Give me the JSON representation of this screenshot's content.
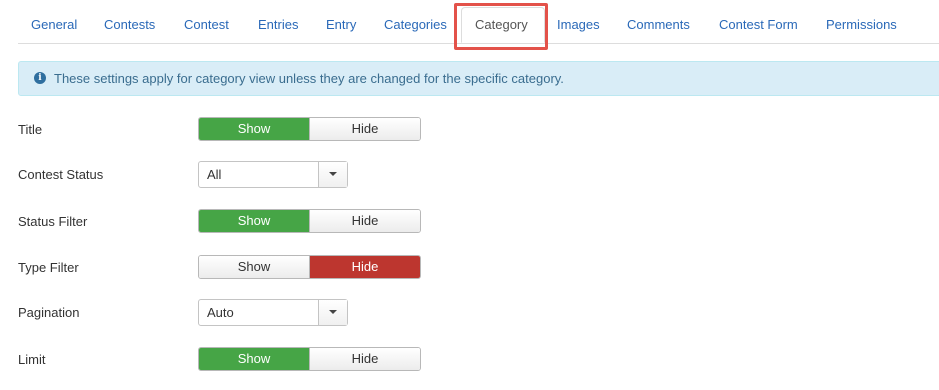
{
  "tabs": [
    {
      "label": "General"
    },
    {
      "label": "Contests"
    },
    {
      "label": "Contest"
    },
    {
      "label": "Entries"
    },
    {
      "label": "Entry"
    },
    {
      "label": "Categories"
    },
    {
      "label": "Category",
      "active": true
    },
    {
      "label": "Images"
    },
    {
      "label": "Comments"
    },
    {
      "label": "Contest Form"
    },
    {
      "label": "Permissions"
    }
  ],
  "alert": {
    "icon": "info-icon",
    "text": "These settings apply for category view unless they are changed for the specific category."
  },
  "settings": {
    "title": {
      "label": "Title",
      "show": "Show",
      "hide": "Hide",
      "selected": "Show"
    },
    "contest_status": {
      "label": "Contest Status",
      "value": "All"
    },
    "status_filter": {
      "label": "Status Filter",
      "show": "Show",
      "hide": "Hide",
      "selected": "Show"
    },
    "type_filter": {
      "label": "Type Filter",
      "show": "Show",
      "hide": "Hide",
      "selected": "Hide"
    },
    "pagination": {
      "label": "Pagination",
      "value": "Auto"
    },
    "limit": {
      "label": "Limit",
      "show": "Show",
      "hide": "Hide",
      "selected": "Show"
    }
  },
  "colors": {
    "show_active": "#46a546",
    "hide_active": "#bd362f",
    "highlight": "#e3524a",
    "link": "#2a69b8"
  }
}
